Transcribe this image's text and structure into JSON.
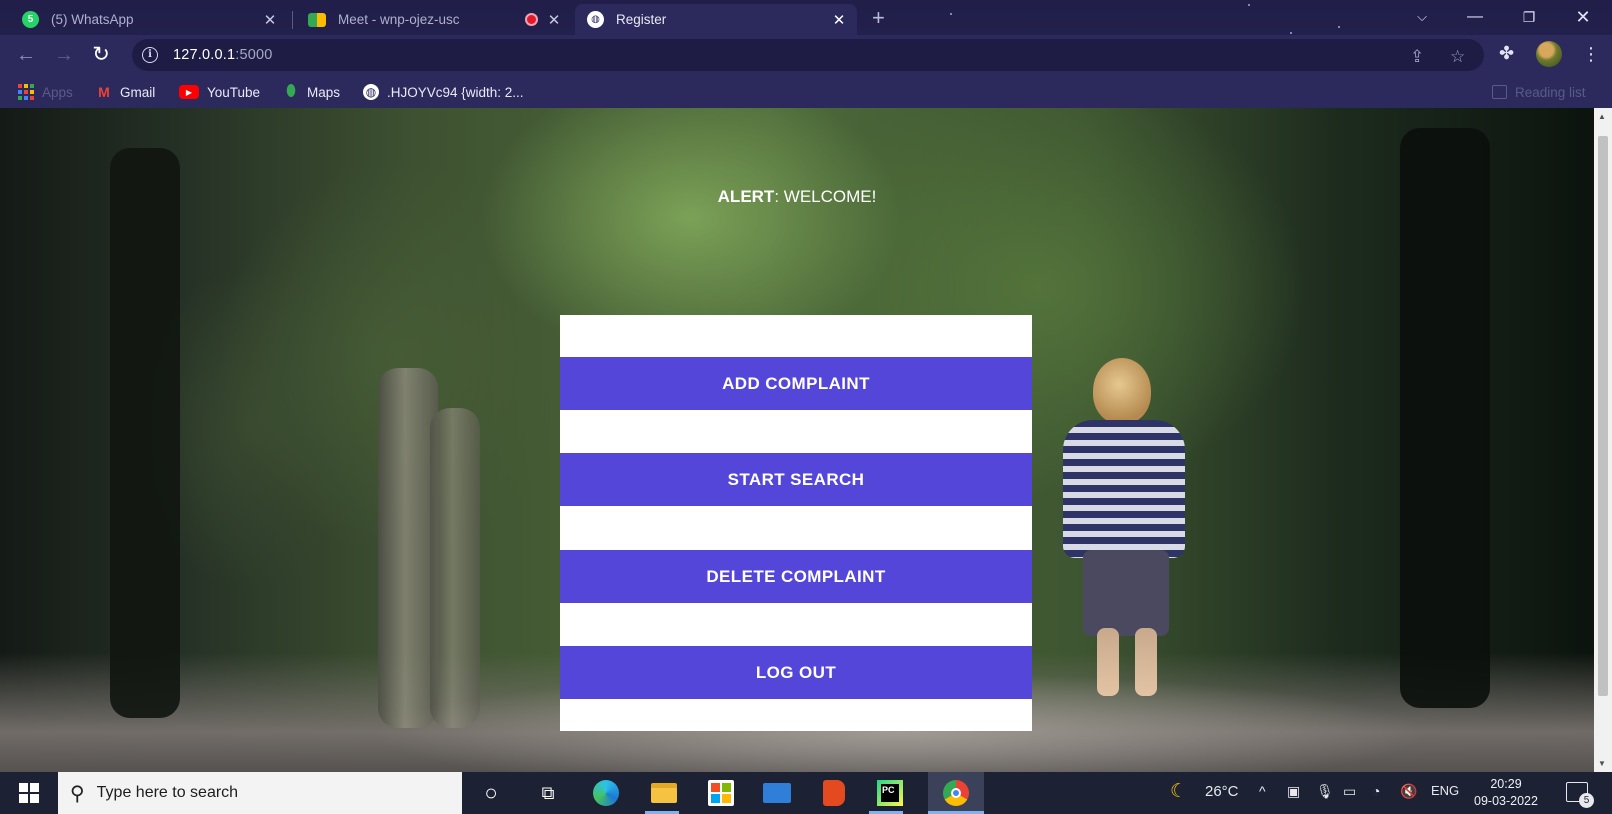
{
  "browser": {
    "tabs": [
      {
        "title": "(5) WhatsApp",
        "badge": "5",
        "favicon": "whatsapp-icon"
      },
      {
        "title": "Meet - wnp-ojez-usc",
        "favicon": "google-meet-icon",
        "recording": true
      },
      {
        "title": "Register",
        "favicon": "globe-icon",
        "active": true
      }
    ],
    "new_tab": "+",
    "url_host": "127.0.0.1",
    "url_port": ":5000",
    "bookmarks": [
      {
        "label": "Apps",
        "icon": "apps-grid-icon"
      },
      {
        "label": "Gmail",
        "icon": "gmail-icon"
      },
      {
        "label": "YouTube",
        "icon": "youtube-icon"
      },
      {
        "label": "Maps",
        "icon": "maps-icon"
      },
      {
        "label": ".HJOYVc94 {width: 2...",
        "icon": "globe-icon"
      }
    ],
    "reading_list": "Reading list"
  },
  "page": {
    "alert_label": "ALERT",
    "alert_message": ": WELCOME!",
    "buttons": {
      "add": "ADD COMPLAINT",
      "search": "START SEARCH",
      "delete": "DELETE COMPLAINT",
      "logout": "LOG OUT"
    },
    "button_color": "#5346d9"
  },
  "taskbar": {
    "search_placeholder": "Type here to search",
    "temperature": "26°C",
    "language": "ENG",
    "time": "20:29",
    "date": "09-03-2022",
    "notifications": "5"
  }
}
